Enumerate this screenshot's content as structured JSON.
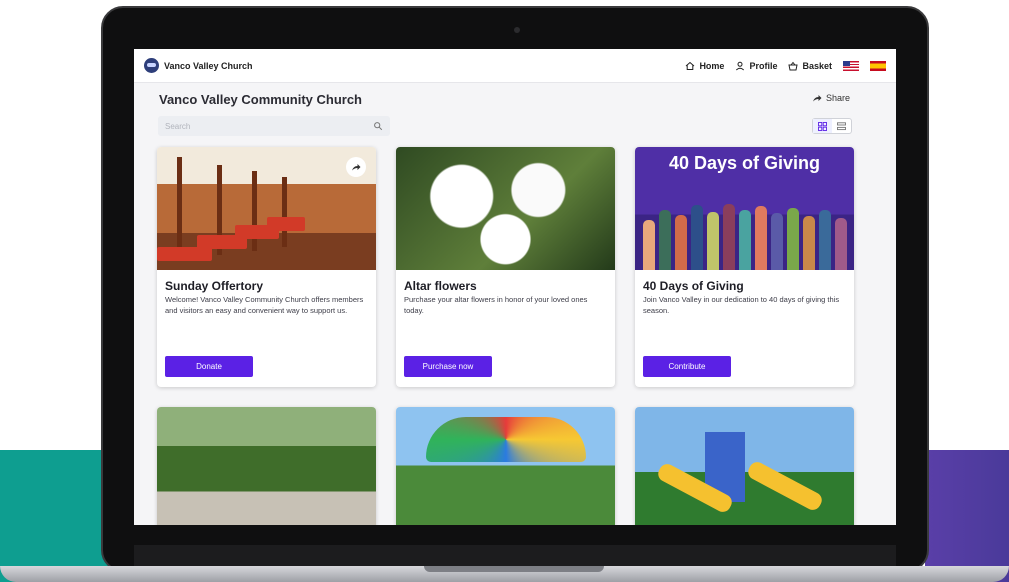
{
  "window": {
    "brand": "Vanco Valley Church"
  },
  "nav": {
    "home": "Home",
    "profile": "Profile",
    "basket": "Basket"
  },
  "page": {
    "title": "Vanco Valley Community Church",
    "share": "Share"
  },
  "search": {
    "placeholder": "Search"
  },
  "cards": [
    {
      "title": "Sunday Offertory",
      "desc": "Welcome! Vanco Valley Community Church offers members and visitors an easy and convenient way to support us.",
      "button": "Donate"
    },
    {
      "title": "Altar flowers",
      "desc": "Purchase your altar flowers in honor of your loved ones today.",
      "button": "Purchase now"
    },
    {
      "title": "40 Days of Giving",
      "desc": "Join Vanco Valley in our dedication to 40 days of giving this season.",
      "button": "Contribute",
      "banner": "40 Days of Giving"
    }
  ],
  "colors": {
    "accent": "#5b21e5",
    "teal": "#0e9e90",
    "purple": "#5a3fa8"
  }
}
